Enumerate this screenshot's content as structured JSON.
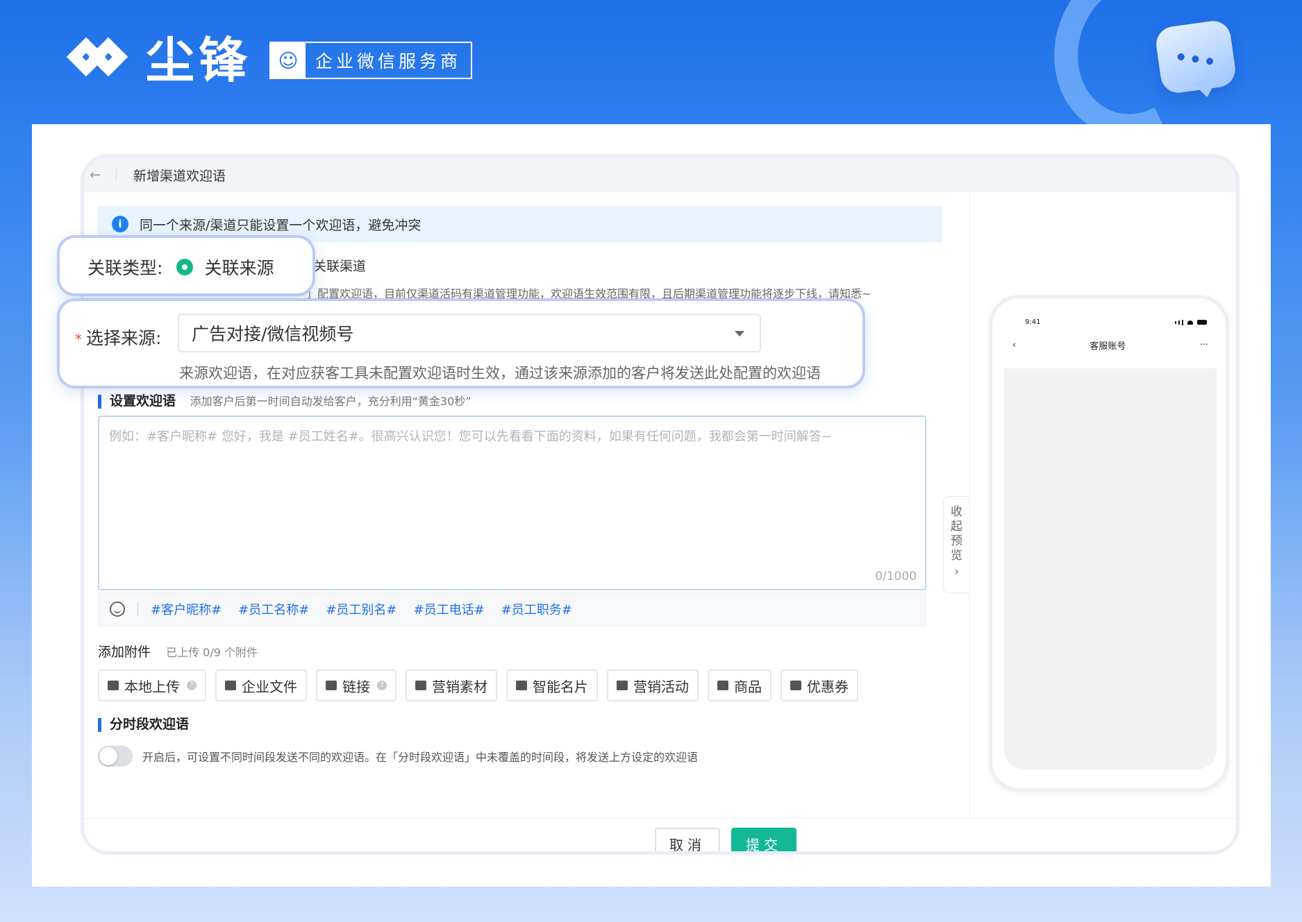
{
  "brand": {
    "name": "尘锋",
    "badge": "企业微信服务商"
  },
  "window": {
    "back": "←",
    "title": "新增渠道欢迎语"
  },
  "notice": {
    "text": "同一个来源/渠道只能设置一个欢迎语，避免冲突"
  },
  "relation": {
    "label": "关联类型:",
    "option_source": "关联来源",
    "option_channel": "关联渠道",
    "desc": "」配置欢迎语，目前仅渠道活码有渠道管理功能，欢迎语生效范围有限，且后期渠道管理功能将逐步下线，请知悉~"
  },
  "source": {
    "required": "*",
    "label": "选择来源:",
    "value": "广告对接/微信视频号",
    "hint": "来源欢迎语，在对应获客工具未配置欢迎语时生效，通过该来源添加的客户将发送此处配置的欢迎语"
  },
  "welcome": {
    "title": "设置欢迎语",
    "subtitle": "添加客户后第一时间自动发给客户，充分利用“黄金30秒”",
    "placeholder": "例如：#客户昵称# 您好，我是 #员工姓名#。很高兴认识您！您可以先看看下面的资料，如果有任何问题，我都会第一时间解答~",
    "counter": "0/1000",
    "tags": [
      "#客户昵称#",
      "#员工名称#",
      "#员工别名#",
      "#员工电话#",
      "#员工职务#"
    ]
  },
  "attachments": {
    "title": "添加附件",
    "uploaded": "已上传 0/9 个附件",
    "buttons": [
      "本地上传",
      "企业文件",
      "链接",
      "营销素材",
      "智能名片",
      "营销活动",
      "商品",
      "优惠券"
    ]
  },
  "timed": {
    "title": "分时段欢迎语",
    "desc": "开启后，可设置不同时间段发送不同的欢迎语。在「分时段欢迎语」中未覆盖的时间段，将发送上方设定的欢迎语"
  },
  "actions": {
    "cancel": "取消",
    "submit": "提交"
  },
  "preview": {
    "collapse": "收起预览",
    "time": "9:41",
    "account": "客服账号",
    "more": "···"
  },
  "colors": {
    "primary": "#1f6fe8",
    "success": "#13b895",
    "radio": "#12b886"
  }
}
